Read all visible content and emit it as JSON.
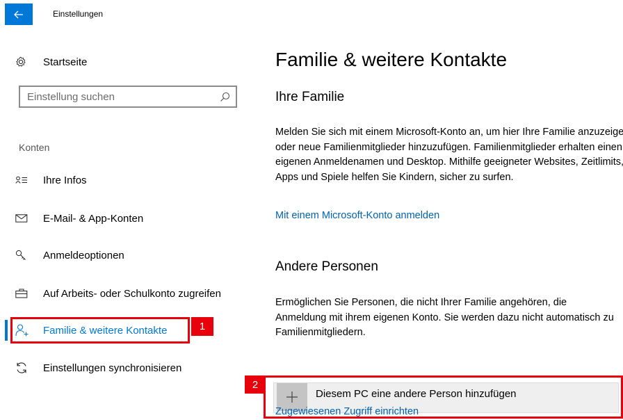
{
  "titlebar": {
    "title": "Einstellungen"
  },
  "sidebar": {
    "home_label": "Startseite",
    "search_placeholder": "Einstellung suchen",
    "section_label": "Konten",
    "items": [
      {
        "label": "Ihre Infos",
        "icon": "contact-card-icon"
      },
      {
        "label": "E-Mail- & App-Konten",
        "icon": "mail-icon"
      },
      {
        "label": "Anmeldeoptionen",
        "icon": "key-icon"
      },
      {
        "label": "Auf Arbeits- oder Schulkonto zugreifen",
        "icon": "briefcase-icon"
      },
      {
        "label": "Familie & weitere Kontakte",
        "icon": "add-person-icon",
        "active": true
      },
      {
        "label": "Einstellungen synchronisieren",
        "icon": "sync-icon"
      }
    ]
  },
  "main": {
    "title": "Familie & weitere Kontakte",
    "family": {
      "heading": "Ihre Familie",
      "text": "Melden Sie sich mit einem Microsoft-Konto an, um hier Ihre Familie anzuzeigen oder neue Familienmitglieder hinzuzufügen. Familienmitglieder erhalten einen eigenen Anmeldenamen und Desktop. Mithilfe geeigneter Websites, Zeitlimits, Apps und Spiele helfen Sie Kindern, sicher zu surfen.",
      "link": "Mit einem Microsoft-Konto anmelden"
    },
    "others": {
      "heading": "Andere Personen",
      "text": "Ermöglichen Sie Personen, die nicht Ihrer Familie angehören, die Anmeldung mit ihrem eigenen Konto. Sie werden dazu nicht automatisch zu Familienmitgliedern.",
      "add_button": "Diesem PC eine andere Person hinzufügen",
      "link": "Zugewiesenen Zugriff einrichten"
    }
  },
  "annotations": {
    "badge1": "1",
    "badge2": "2"
  },
  "colors": {
    "accent": "#0078d7",
    "link": "#0063b1",
    "highlight": "#e8000b"
  }
}
